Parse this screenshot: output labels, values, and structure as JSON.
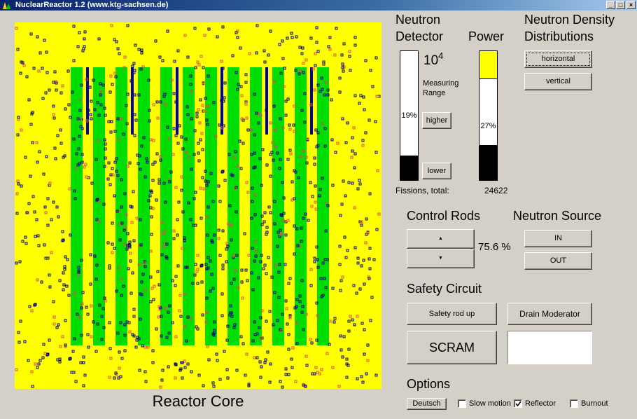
{
  "window": {
    "title": "NuclearReactor 1.2 (www.ktg-sachsen.de)",
    "controls": {
      "minimize": "_",
      "maximize": "□",
      "close": "×"
    }
  },
  "core": {
    "label": "Reactor Core",
    "colors": {
      "background": "#ffff00",
      "fuel": "#00dd00",
      "control_rod": "#0000b4",
      "fast_neutron": "#e05050",
      "thermal_neutron": "#000080"
    }
  },
  "detector": {
    "heading_line1": "Neutron",
    "heading_line2": "Detector",
    "exponent_base": "10",
    "exponent": "4",
    "range_line1": "Measuring",
    "range_line2": "Range",
    "higher_label": "higher",
    "lower_label": "lower",
    "percent_text": "19%",
    "level": 0.19
  },
  "power": {
    "heading": "Power",
    "percent_text": "27%",
    "level": 0.27,
    "overflow_marker": 0.22
  },
  "fissions": {
    "label": "Fissions, total:",
    "value": "24622"
  },
  "density": {
    "heading_line1": "Neutron Density",
    "heading_line2": "Distributions",
    "horizontal_label": "horizontal",
    "vertical_label": "vertical"
  },
  "control_rods": {
    "heading": "Control Rods",
    "up_glyph": "▲",
    "down_glyph": "▼",
    "value_text": "75.6 %"
  },
  "neutron_source": {
    "heading": "Neutron Source",
    "in_label": "IN",
    "out_label": "OUT"
  },
  "safety": {
    "heading": "Safety Circuit",
    "safety_rod_label": "Safety rod up",
    "drain_label": "Drain Moderator",
    "scram_label": "SCRAM",
    "status_text": ""
  },
  "options": {
    "heading": "Options",
    "language_label": "Deutsch",
    "slow_motion_label": "Slow motion",
    "slow_motion_checked": false,
    "reflector_label": "Reflector",
    "reflector_checked": true,
    "burnout_label": "Burnout",
    "burnout_checked": false
  }
}
